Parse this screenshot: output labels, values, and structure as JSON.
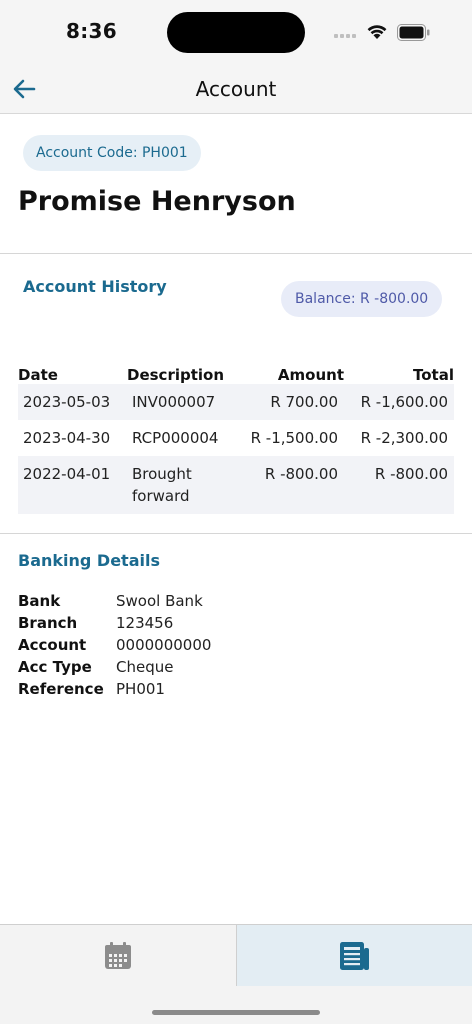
{
  "status_bar": {
    "time": "8:36"
  },
  "nav": {
    "title": "Account"
  },
  "account": {
    "code_label": "Account Code: PH001",
    "name": "Promise Henryson"
  },
  "history": {
    "title": "Account History",
    "balance_label": "Balance: R -800.00",
    "columns": [
      "Date",
      "Description",
      "Amount",
      "Total"
    ],
    "rows": [
      {
        "date": "2023-05-03",
        "description": "INV000007",
        "amount": "R 700.00",
        "total": "R -1,600.00"
      },
      {
        "date": "2023-04-30",
        "description": "RCP000004",
        "amount": "R -1,500.00",
        "total": "R -2,300.00"
      },
      {
        "date": "2022-04-01",
        "description": "Brought forward",
        "amount": "R -800.00",
        "total": "R -800.00"
      }
    ]
  },
  "banking": {
    "title": "Banking Details",
    "rows": [
      {
        "label": "Bank",
        "value": "Swool Bank"
      },
      {
        "label": "Branch",
        "value": "123456"
      },
      {
        "label": "Account",
        "value": "0000000000"
      },
      {
        "label": "Acc Type",
        "value": "Cheque"
      },
      {
        "label": "Reference",
        "value": "PH001"
      }
    ]
  },
  "tabs": [
    {
      "icon": "calendar-icon",
      "active": false
    },
    {
      "icon": "statement-icon",
      "active": true
    }
  ],
  "colors": {
    "accent": "#1b6a8f",
    "balance_text": "#4f5aa8",
    "row_shade": "#f2f3f7"
  }
}
